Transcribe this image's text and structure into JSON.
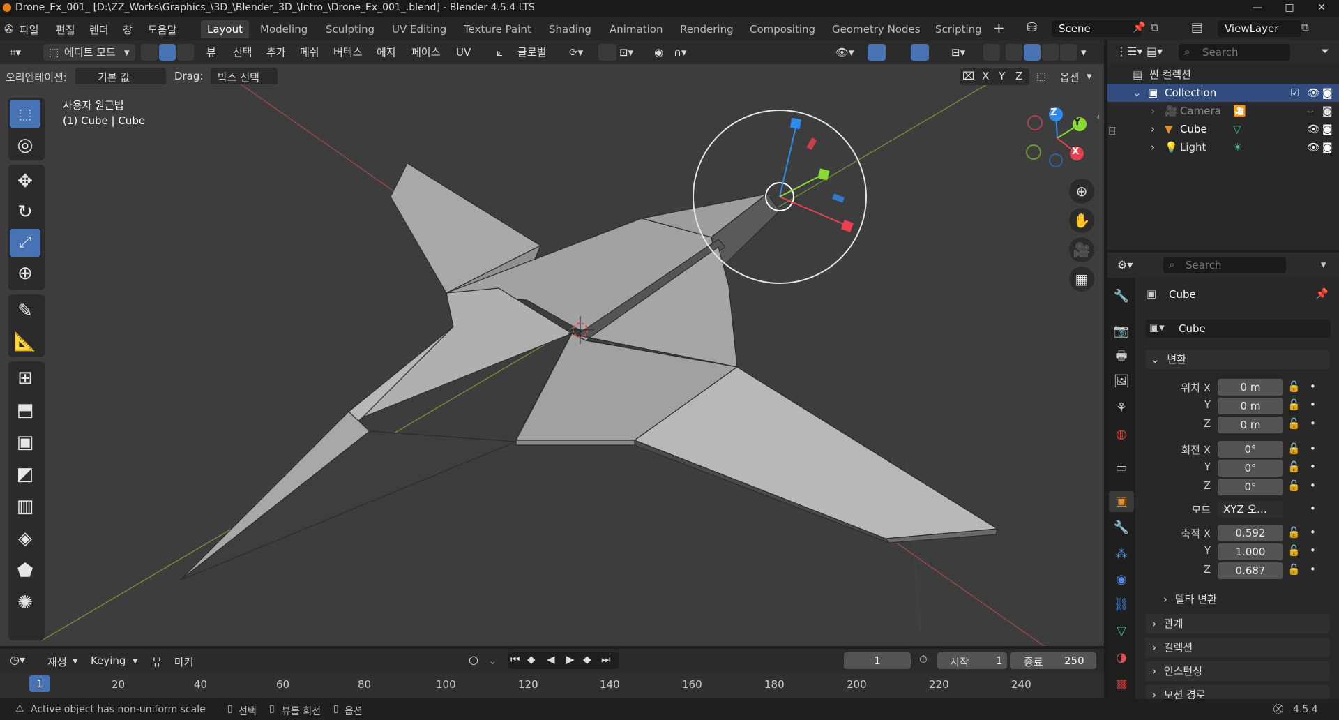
{
  "window": {
    "title": "Drone_Ex_001_ [D:\\ZZ_Works\\Graphics_\\3D_\\Blender_3D_\\Intro_\\Drone_Ex_001_.blend] - Blender 4.5.4 LTS",
    "controls": [
      "—",
      "□",
      "✕"
    ]
  },
  "menu": [
    "파일",
    "편집",
    "렌더",
    "창",
    "도움말"
  ],
  "workspaces": [
    "Layout",
    "Modeling",
    "Sculpting",
    "UV Editing",
    "Texture Paint",
    "Shading",
    "Animation",
    "Rendering",
    "Compositing",
    "Geometry Nodes",
    "Scripting"
  ],
  "active_workspace": "Layout",
  "scene": "Scene",
  "view_layer": "ViewLayer",
  "viewport_header": {
    "mode": "에디트 모드",
    "menus": [
      "뷰",
      "선택",
      "추가",
      "메쉬",
      "버텍스",
      "에지",
      "페이스",
      "UV"
    ],
    "transform_orientation": "글로벌",
    "axes": [
      "X",
      "Y",
      "Z"
    ],
    "options": "옵션"
  },
  "tool_settings": {
    "orientation_label": "오리엔테이션:",
    "orientation_value": "기본 값",
    "drag_label": "Drag:",
    "drag_value": "박스 선택"
  },
  "viewport_info": {
    "view_name": "사용자 원근법",
    "object_info": "(1) Cube | Cube"
  },
  "gizmo_axes": {
    "x": "X",
    "y": "Y",
    "z": "Z"
  },
  "colors": {
    "accent": "#4772b3",
    "x_axis": "#e8404f",
    "y_axis": "#8bdc32",
    "z_axis": "#2d8ceb",
    "viewport_bg": "#3d3d3d",
    "mesh_face": "#a6a6a6"
  },
  "outliner": {
    "search_placeholder": "Search",
    "scene_collection": "씬 컬렉션",
    "items": [
      {
        "name": "Collection",
        "icon": "collection-icon"
      },
      {
        "name": "Camera",
        "icon": "camera-icon"
      },
      {
        "name": "Cube",
        "icon": "mesh-icon"
      },
      {
        "name": "Light",
        "icon": "light-icon"
      }
    ]
  },
  "properties": {
    "search_placeholder": "Search",
    "object_name": "Cube",
    "data_name": "Cube",
    "transform_header": "변환",
    "location_label": "위치 X",
    "rotation_label": "회전 X",
    "scale_label": "축적 X",
    "axis_y": "Y",
    "axis_z": "Z",
    "location": [
      "0 m",
      "0 m",
      "0 m"
    ],
    "rotation": [
      "0°",
      "0°",
      "0°"
    ],
    "mode_label": "모드",
    "mode_value": "XYZ 오...",
    "scale": [
      "0.592",
      "1.000",
      "0.687"
    ],
    "delta": "델타 변환",
    "panels": [
      "관계",
      "컬렉션",
      "인스턴싱",
      "모션 경로"
    ]
  },
  "timeline": {
    "menus": [
      "재생",
      "Keying",
      "뷰",
      "마커"
    ],
    "current_frame": "1",
    "start_label": "시작",
    "start_value": "1",
    "end_label": "종료",
    "end_value": "250",
    "ruler": [
      "1",
      "20",
      "40",
      "60",
      "80",
      "100",
      "120",
      "140",
      "160",
      "180",
      "200",
      "220",
      "240"
    ]
  },
  "status": {
    "warning": "Active object has non-uniform scale",
    "hints": [
      "선택",
      "뷰를 회전",
      "옵션"
    ],
    "version": "4.5.4"
  }
}
